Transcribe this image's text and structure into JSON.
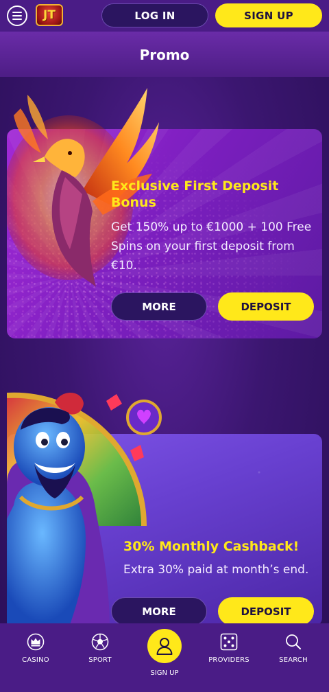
{
  "header": {
    "logo_text": "JT",
    "login_label": "LOG IN",
    "signup_label": "SIGN UP"
  },
  "page": {
    "title": "Promo"
  },
  "promos": [
    {
      "title": "Exclusive First Deposit Bonus",
      "description": "Get 150% up to €1000 + 100 Free Spins on your first deposit from €10.",
      "more_label": "MORE",
      "deposit_label": "DEPOSIT"
    },
    {
      "title": "30% Monthly Cashback!",
      "description": "Extra 30% paid at month’s end.",
      "more_label": "MORE",
      "deposit_label": "DEPOSIT"
    }
  ],
  "bottom_nav": {
    "items": [
      {
        "label": "CASINO",
        "icon": "crown-icon"
      },
      {
        "label": "SPORT",
        "icon": "soccer-ball-icon"
      },
      {
        "label": "SIGN UP",
        "icon": "user-icon"
      },
      {
        "label": "PROVIDERS",
        "icon": "dice-icon"
      },
      {
        "label": "SEARCH",
        "icon": "search-icon"
      }
    ]
  },
  "colors": {
    "accent_yellow": "#ffe81a",
    "header_purple": "#4a1c86",
    "button_dark": "#2b1560"
  }
}
